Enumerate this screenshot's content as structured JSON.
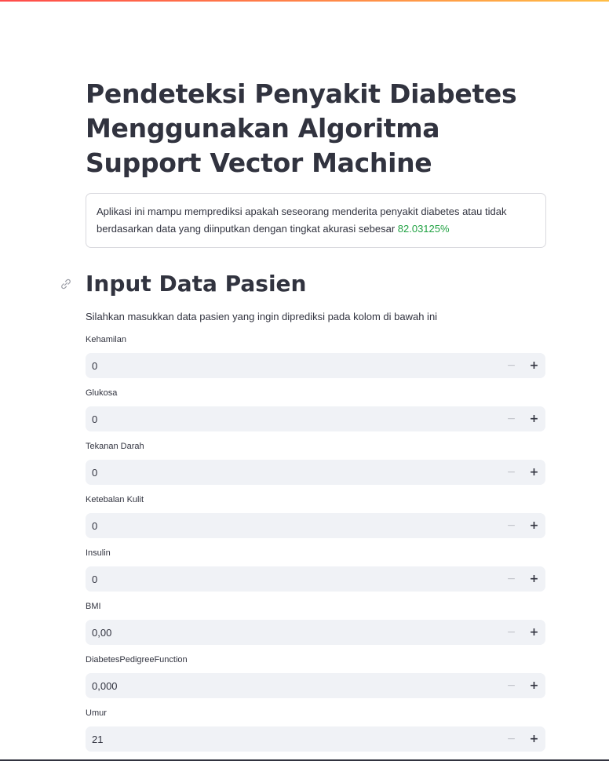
{
  "title": "Pendeteksi Penyakit Diabetes Menggunakan Algoritma Support Vector Machine",
  "info": {
    "text": "Aplikasi ini mampu memprediksi apakah seseorang menderita penyakit diabetes atau tidak berdasarkan data yang diinputkan dengan tingkat akurasi sebesar ",
    "accuracy": "82.03125%"
  },
  "section": {
    "heading": "Input Data Pasien",
    "subtitle": "Silahkan masukkan data pasien yang ingin diprediksi pada kolom di bawah ini"
  },
  "fields": [
    {
      "label": "Kehamilan",
      "value": "0"
    },
    {
      "label": "Glukosa",
      "value": "0"
    },
    {
      "label": "Tekanan Darah",
      "value": "0"
    },
    {
      "label": "Ketebalan Kulit",
      "value": "0"
    },
    {
      "label": "Insulin",
      "value": "0"
    },
    {
      "label": "BMI",
      "value": "0,00"
    },
    {
      "label": "DiabetesPedigreeFunction",
      "value": "0,000"
    },
    {
      "label": "Umur",
      "value": "21"
    }
  ],
  "stepper": {
    "minus": "−",
    "plus": "+"
  },
  "colors": {
    "accent_gradient_start": "#ff4b4b",
    "accent_gradient_end": "#ffbd45",
    "accuracy": "#21a243",
    "input_bg": "#f0f2f6"
  },
  "icons": {
    "section_anchor": "link-icon"
  }
}
